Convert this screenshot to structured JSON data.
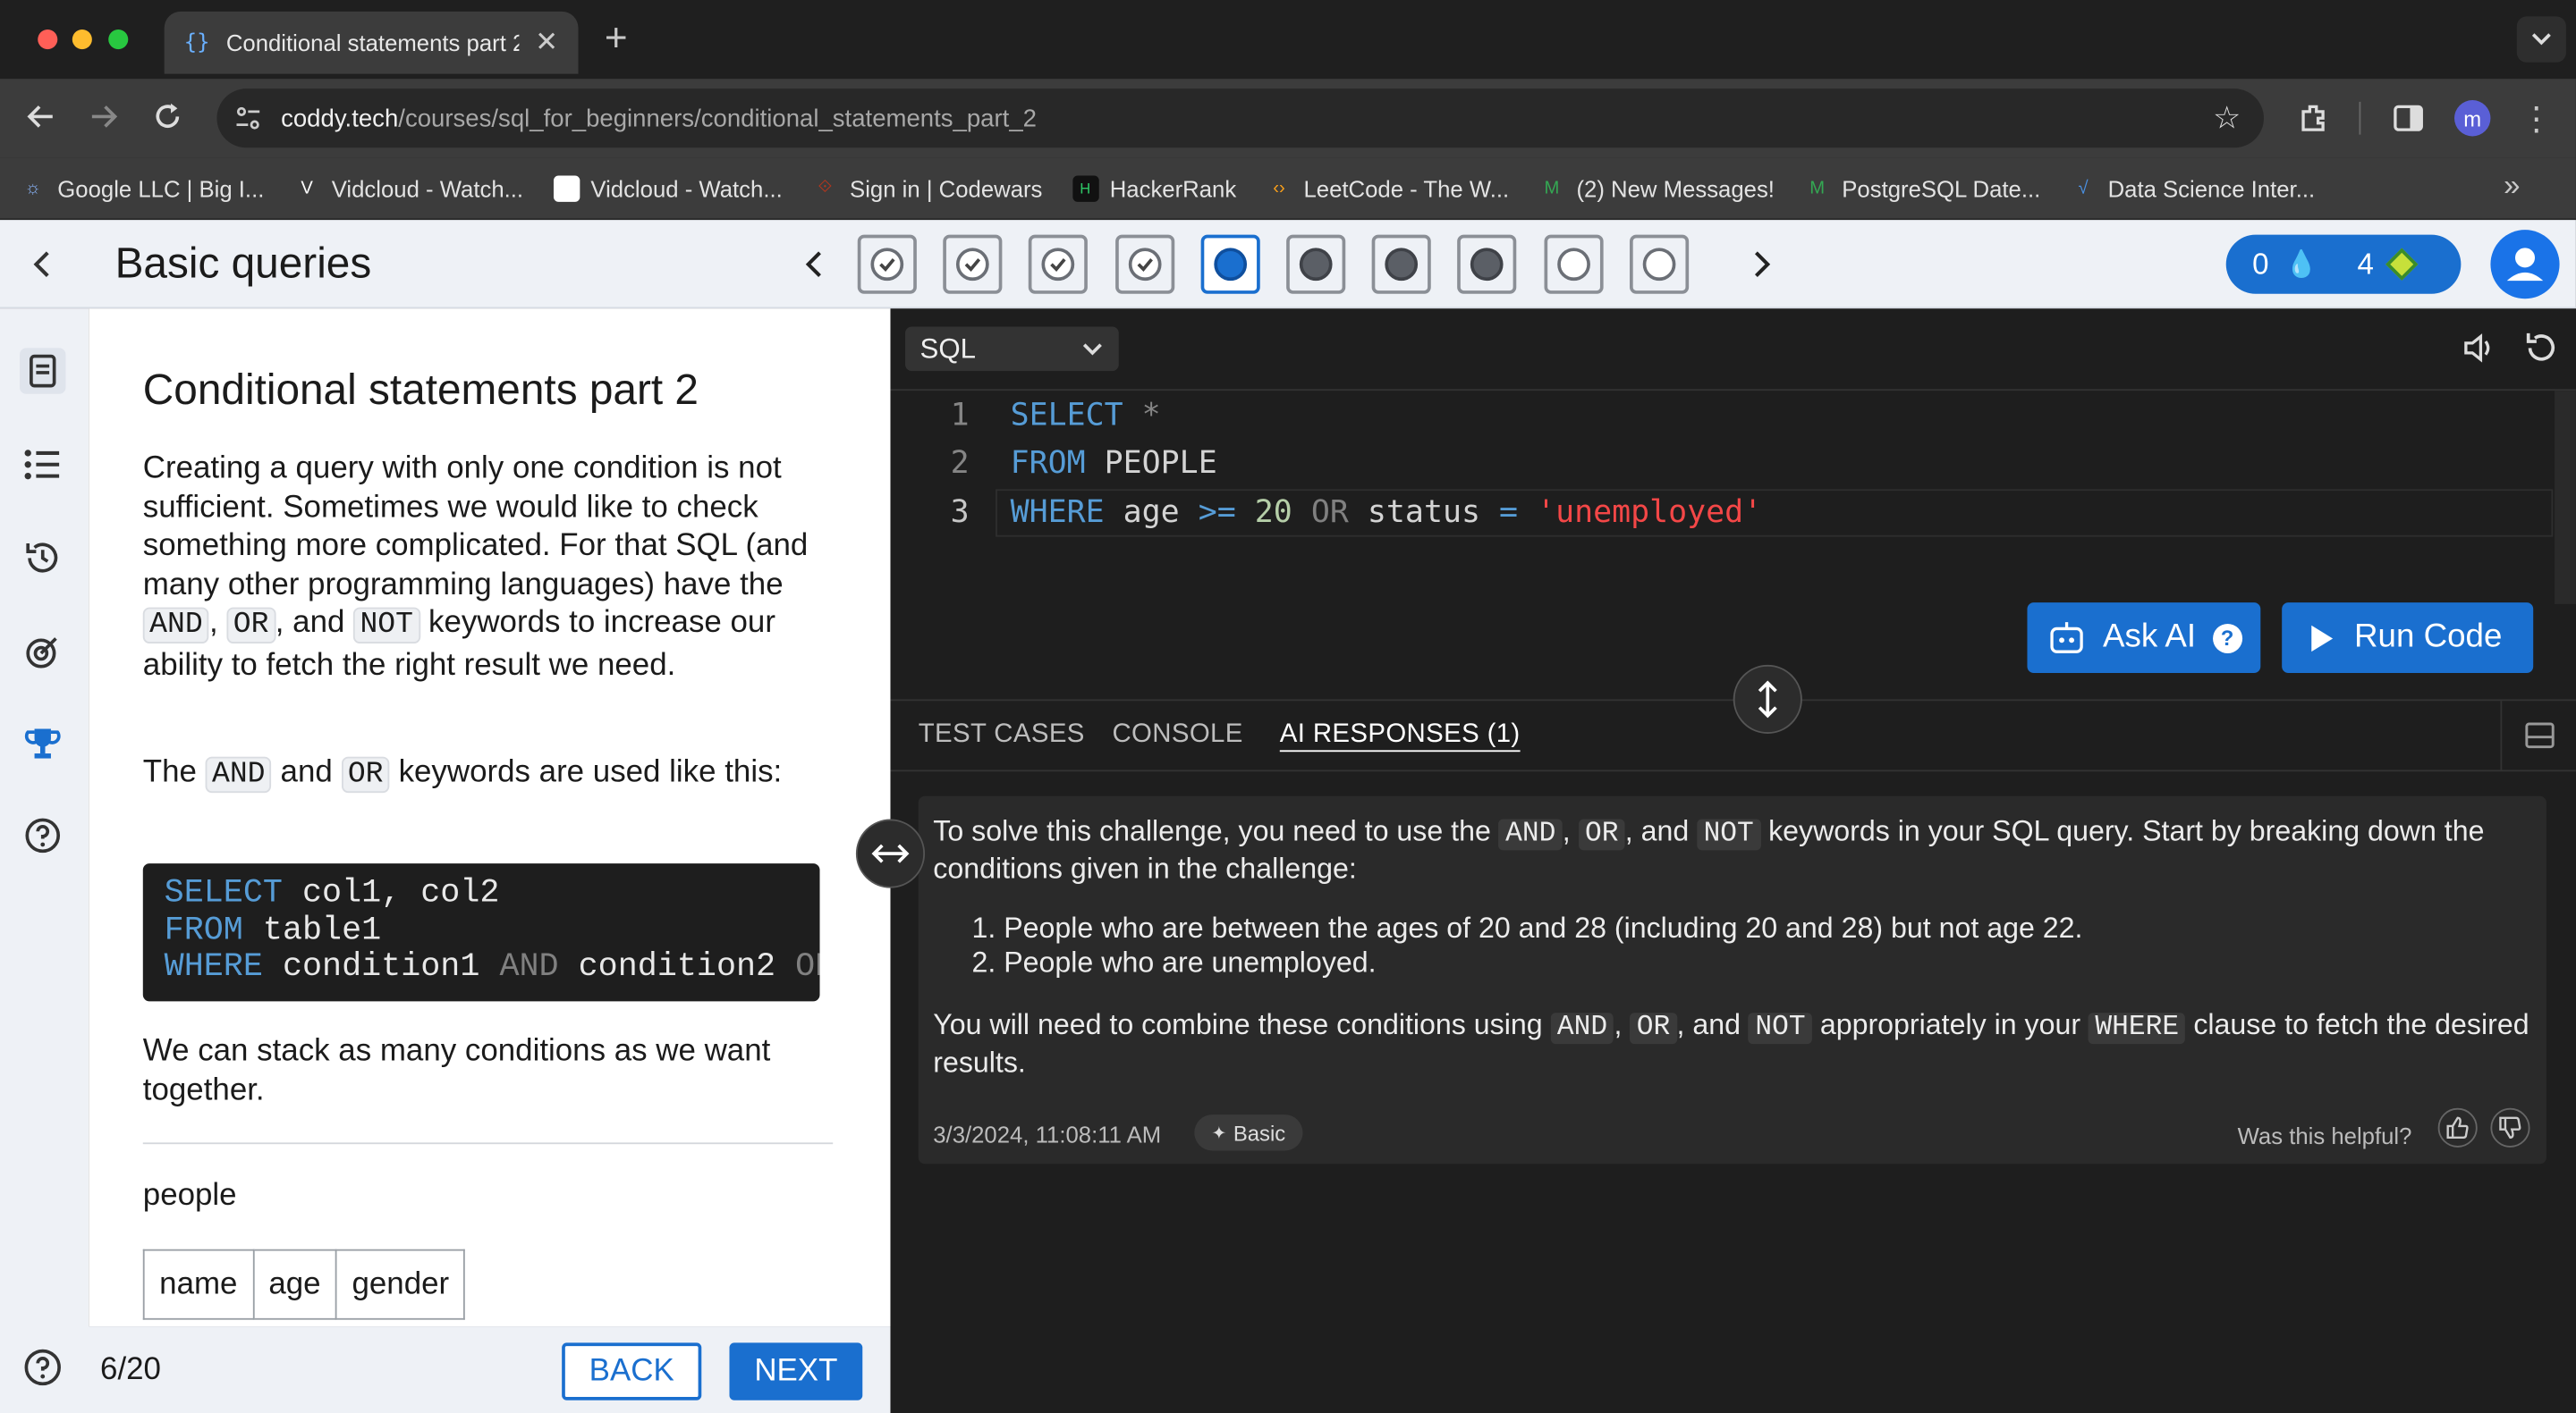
{
  "browser": {
    "tab_title": "Conditional statements part 2",
    "url_host": "coddy.tech",
    "url_path": "/courses/sql_for_beginners/conditional_statements_part_2",
    "profile_initial": "m",
    "bookmarks": [
      {
        "label": "Google LLC | Big I...",
        "icon": "google-icon",
        "color": "#8ab4f8"
      },
      {
        "label": "Vidcloud - Watch...",
        "icon": "vidcloud-icon",
        "color": "#ffffff"
      },
      {
        "label": "Vidcloud - Watch...",
        "icon": "blank-page-icon",
        "color": "#ffffff"
      },
      {
        "label": "Sign in | Codewars",
        "icon": "codewars-icon",
        "color": "#b1361e"
      },
      {
        "label": "HackerRank",
        "icon": "hackerrank-icon",
        "color": "#2ec866"
      },
      {
        "label": "LeetCode - The W...",
        "icon": "leetcode-icon",
        "color": "#f89f1b"
      },
      {
        "label": "(2) New Messages!",
        "icon": "gmail-icon",
        "color": "#34a853"
      },
      {
        "label": "PostgreSQL Date...",
        "icon": "gmail-icon",
        "color": "#34a853"
      },
      {
        "label": "Data Science Inter...",
        "icon": "datascience-icon",
        "color": "#4a90e2"
      }
    ]
  },
  "header": {
    "title": "Basic queries",
    "steps": [
      "done",
      "done",
      "done",
      "done",
      "current",
      "locked",
      "locked",
      "locked",
      "empty",
      "empty"
    ],
    "streak": "0",
    "gems": "4"
  },
  "lesson": {
    "title": "Conditional statements part 2",
    "p1_a": "Creating a query with only one condition is not sufficient. Sometimes we would like to check something more complicated. For that SQL (and many other programming languages) have the ",
    "kw_and": "AND",
    "sep1": ", ",
    "kw_or": "OR",
    "sep2": ", and ",
    "kw_not": "NOT",
    "p1_b": " keywords to increase our ability to fetch the right result we need.",
    "p2_a": "The ",
    "p2_b": " and ",
    "p2_c": " keywords are used like this:",
    "code": {
      "l1_kw": "SELECT",
      "l1_rest": " col1, col2",
      "l2_kw": "FROM",
      "l2_rest": " table1",
      "l3_kw": "WHERE",
      "l3_a": " condition1 ",
      "l3_and": "AND",
      "l3_b": " condition2 ",
      "l3_or": "OR"
    },
    "p3": "We can stack as many conditions as we want together.",
    "table_name": "people",
    "table_headers": [
      "name",
      "age",
      "gender"
    ],
    "progress": "6/20",
    "back_label": "BACK",
    "next_label": "NEXT"
  },
  "editor": {
    "language": "SQL",
    "lines": [
      {
        "n": "1",
        "parts": [
          {
            "t": "SELECT",
            "c": "#569cd6"
          },
          {
            "t": " ",
            "c": "#d4d4d4"
          },
          {
            "t": "*",
            "c": "#858585"
          }
        ]
      },
      {
        "n": "2",
        "parts": [
          {
            "t": "FROM",
            "c": "#569cd6"
          },
          {
            "t": " PEOPLE",
            "c": "#d4d4d4"
          }
        ]
      },
      {
        "n": "3",
        "parts": [
          {
            "t": "WHERE",
            "c": "#569cd6"
          },
          {
            "t": " age ",
            "c": "#d4d4d4"
          },
          {
            "t": ">=",
            "c": "#569cd6"
          },
          {
            "t": " ",
            "c": "#d4d4d4"
          },
          {
            "t": "20",
            "c": "#b5cea8"
          },
          {
            "t": " ",
            "c": "#d4d4d4"
          },
          {
            "t": "OR",
            "c": "#808080"
          },
          {
            "t": " status ",
            "c": "#d4d4d4"
          },
          {
            "t": "=",
            "c": "#569cd6"
          },
          {
            "t": " ",
            "c": "#d4d4d4"
          },
          {
            "t": "'unemployed'",
            "c": "#f44747"
          }
        ]
      }
    ],
    "ask_ai_label": "Ask AI",
    "run_label": "Run Code"
  },
  "output": {
    "tabs": [
      "TEST CASES",
      "CONSOLE",
      "AI RESPONSES (1)"
    ],
    "active_tab": "AI RESPONSES (1)",
    "response": {
      "intro_a": "To solve this challenge, you need to use the ",
      "intro_b": " keywords in your SQL query. Start by breaking down the conditions given in the challenge:",
      "items": [
        "People who are between the ages of 20 and 28 (including 20 and 28) but not age 22.",
        "People who are unemployed."
      ],
      "outro_a": "You will need to combine these conditions using ",
      "outro_b": " appropriately in your ",
      "kw_where": "WHERE",
      "outro_c": " clause to fetch the desired results.",
      "timestamp": "3/3/2024, 11:08:11 AM",
      "badge": "Basic",
      "helpful": "Was this helpful?"
    }
  }
}
